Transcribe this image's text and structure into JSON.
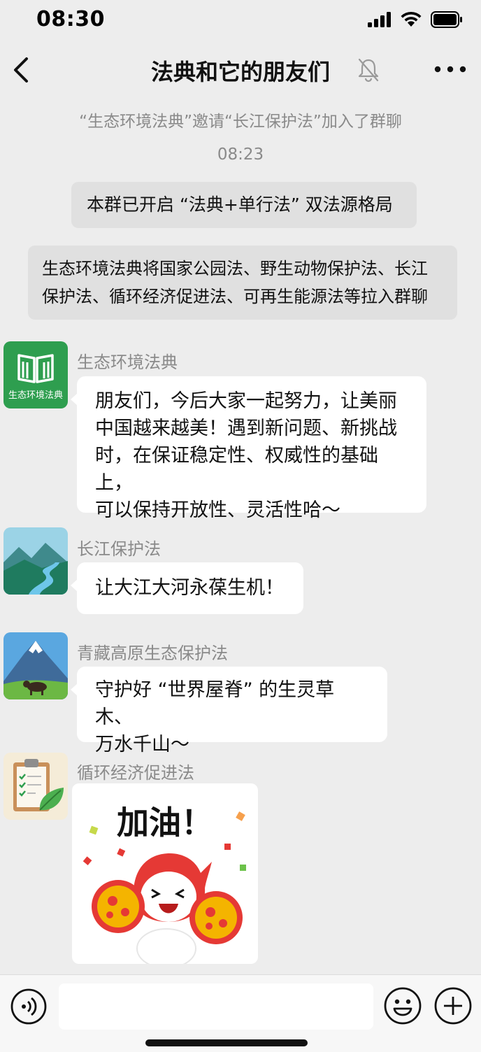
{
  "status_bar": {
    "time": "08:30"
  },
  "header": {
    "title": "法典和它的朋友们"
  },
  "system_notice": "“生态环境法典”邀请“长江保护法”加入了群聊",
  "timestamp": "08:23",
  "announcement": "本群已开启 “法典+单行法” 双法源格局",
  "notice_lines": [
    "生态环境法典将国家公园法、野生动物保护法、长江",
    "保护法、循环经济促进法、可再生能源法等拉入群聊"
  ],
  "messages": [
    {
      "sender": "生态环境法典",
      "avatar_caption": "生态环境法典",
      "lines": [
        "朋友们，今后大家一起努力，让美丽",
        "中国越来越美！遇到新问题、新挑战",
        "时，在保证稳定性、权威性的基础上，",
        "可以保持开放性、灵活性哈～"
      ]
    },
    {
      "sender": "长江保护法",
      "lines": [
        "让大江大河永葆生机！"
      ]
    },
    {
      "sender": "青藏高原生态保护法",
      "lines": [
        "守护好 “世界屋脊” 的生灵草木、",
        "万水千山～"
      ]
    },
    {
      "sender": "循环经济促进法",
      "sticker_text": "加油！"
    }
  ],
  "colors": {
    "background": "#ededed",
    "bubble": "#ffffff",
    "announcement": "#e0e0e0",
    "codex_green": "#2e9e4f",
    "sticker_red": "#e53935"
  },
  "icons": [
    "back-icon",
    "mute-bell-icon",
    "more-icon",
    "voice-icon",
    "emoji-icon",
    "plus-icon",
    "book-icon"
  ]
}
